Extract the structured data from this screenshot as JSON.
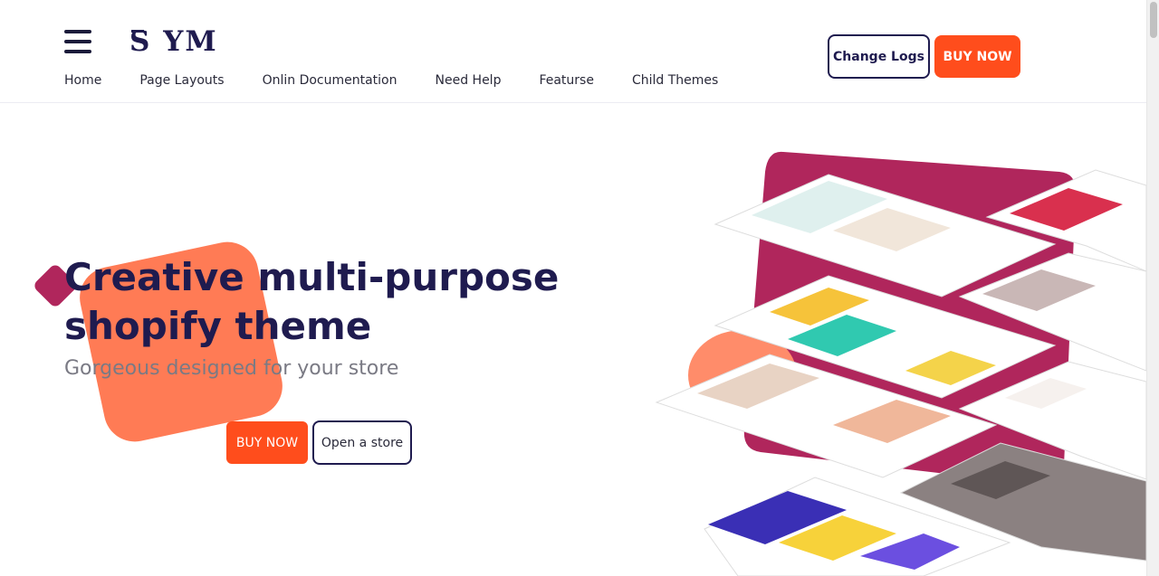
{
  "header": {
    "logo_text": "YM",
    "logo_s": "S",
    "nav": [
      {
        "label": "Home"
      },
      {
        "label": "Page Layouts"
      },
      {
        "label": "Onlin Documentation"
      },
      {
        "label": "Need Help"
      },
      {
        "label": "Featurse"
      },
      {
        "label": "Child Themes"
      }
    ],
    "change_logs_label": "Change Logs",
    "buy_now_label": "BUY NOW"
  },
  "hero": {
    "title_line1": "Creative multi-purpose",
    "title_strong": "shopify",
    "title_rest": " theme",
    "subtitle": "Gorgeous designed for your store",
    "buy_now_label": "BUY NOW",
    "open_store_label": "Open a store"
  },
  "colors": {
    "accent_orange": "#ff4d1c",
    "brand_navy": "#1f1b4f",
    "magenta": "#b0265c",
    "deco_orange": "#ff7b55"
  },
  "icons": {
    "menu": "hamburger-menu-icon"
  }
}
